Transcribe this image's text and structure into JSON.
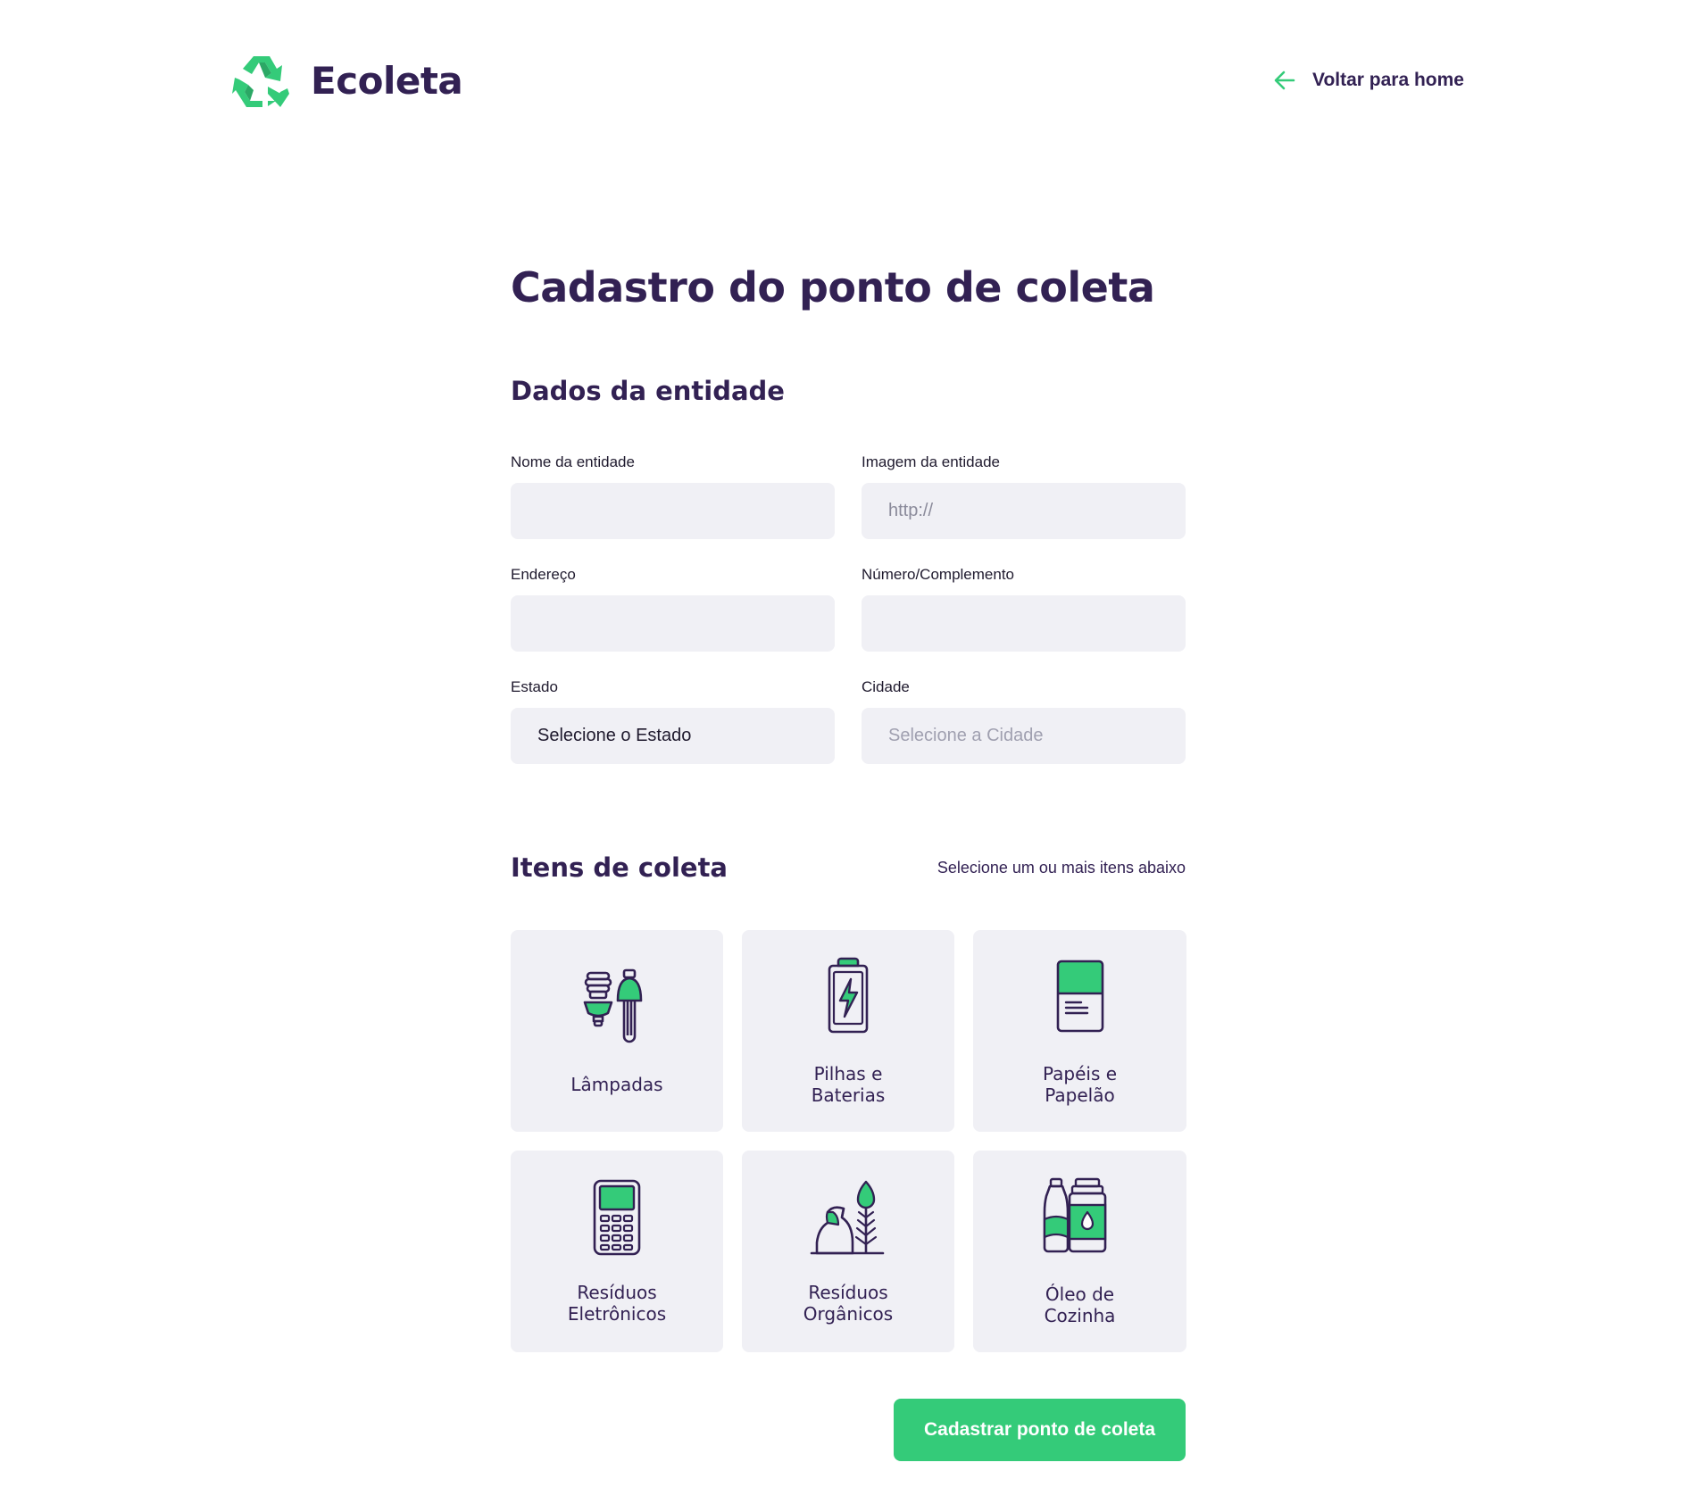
{
  "header": {
    "brand_name": "Ecoleta",
    "logo_icon": "recycle-icon",
    "back_link_label": "Voltar para home",
    "back_icon": "arrow-left-icon"
  },
  "form": {
    "title": "Cadastro do ponto de coleta",
    "entity_section": {
      "title": "Dados da entidade",
      "fields": {
        "name": {
          "label": "Nome da entidade",
          "value": "",
          "placeholder": ""
        },
        "image": {
          "label": "Imagem da entidade",
          "value": "",
          "placeholder": "http://"
        },
        "address": {
          "label": "Endereço",
          "value": "",
          "placeholder": ""
        },
        "number": {
          "label": "Número/Complemento",
          "value": "",
          "placeholder": ""
        },
        "state": {
          "label": "Estado",
          "selected": "Selecione o Estado"
        },
        "city": {
          "label": "Cidade",
          "selected": "Selecione a Cidade"
        }
      }
    },
    "items_section": {
      "title": "Itens de coleta",
      "hint": "Selecione um ou mais itens abaixo",
      "items": [
        {
          "label": "Lâmpadas",
          "icon": "lamps-icon"
        },
        {
          "label": "Pilhas e Baterias",
          "icon": "battery-icon"
        },
        {
          "label": "Papéis e Papelão",
          "icon": "paper-icon"
        },
        {
          "label": "Resíduos Eletrônicos",
          "icon": "electronics-icon"
        },
        {
          "label": "Resíduos Orgânicos",
          "icon": "organic-icon"
        },
        {
          "label": "Óleo de Cozinha",
          "icon": "oil-icon"
        }
      ]
    },
    "submit_label": "Cadastrar ponto de coleta"
  },
  "colors": {
    "primary": "#34cb79",
    "title": "#322153",
    "input_bg": "#f0f0f5",
    "background": "#ffffff"
  }
}
